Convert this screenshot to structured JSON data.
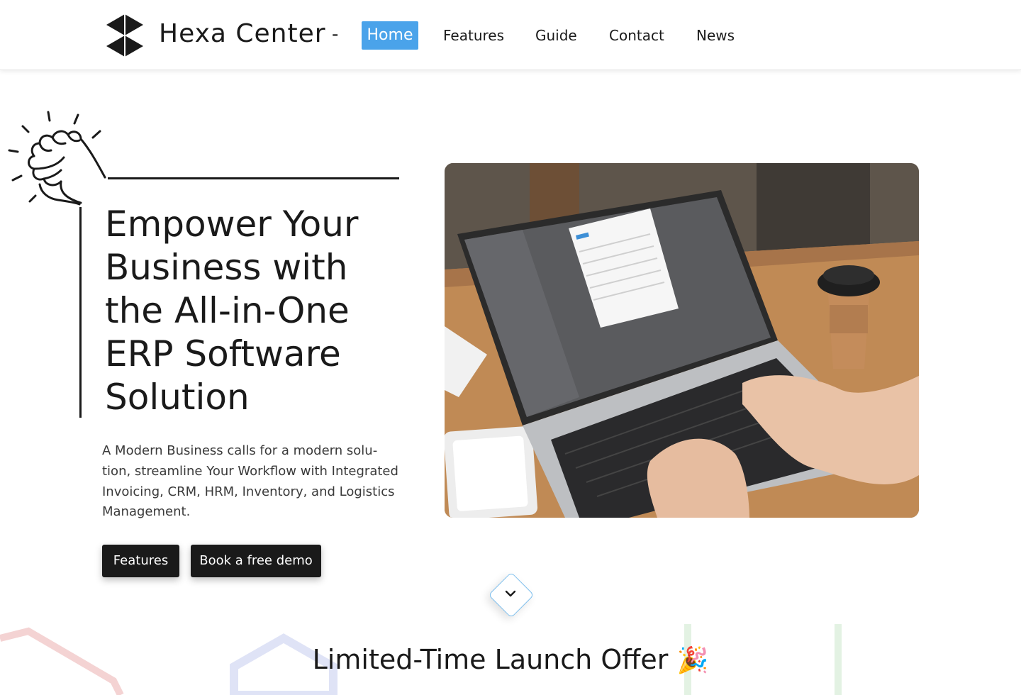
{
  "brand": {
    "name": "Hexa Center",
    "separator": "-",
    "logo_icon": "hexa-cube-logo"
  },
  "nav": [
    {
      "label": "Home",
      "active": true
    },
    {
      "label": "Features"
    },
    {
      "label": "Guide"
    },
    {
      "label": "Contact"
    },
    {
      "label": "News"
    }
  ],
  "hero": {
    "headline": "Empower Your Business with the All-in-One ERP Software Solution",
    "subtext": "A Modern Business calls for a modern solu- tion, streamline Your Workflow with Integrated Invoicing, CRM, HRM, Inventory, and Logistics Management.",
    "buttons": {
      "features": "Features",
      "demo": "Book a free demo"
    },
    "illustration_icon": "raised-fist-icon",
    "image_subject": "laptop-with-erp-app-photo"
  },
  "scroll_icon": "chevron-down-icon",
  "offer": {
    "title": "Limited-Time Launch Offer",
    "emoji": "🎉"
  },
  "colors": {
    "accent": "#4aa3ea",
    "dark": "#1a1a1a",
    "text": "#3a3a3a"
  }
}
